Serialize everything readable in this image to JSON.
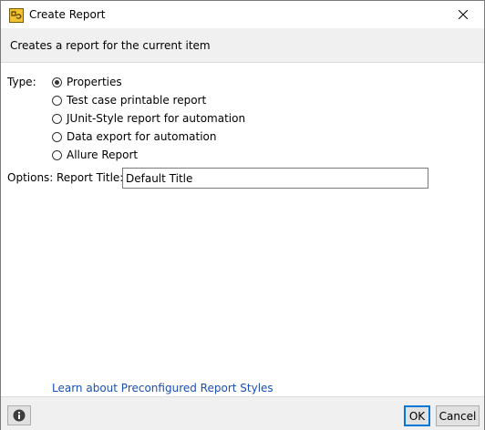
{
  "window": {
    "title": "Create Report",
    "app_icon": "report-app-icon",
    "close_icon": "close-icon"
  },
  "banner": {
    "text": "Creates a report for the current item"
  },
  "form": {
    "type_label": "Type:",
    "report_types": [
      {
        "label": "Properties",
        "selected": true
      },
      {
        "label": "Test case printable report",
        "selected": false
      },
      {
        "label": "JUnit-Style report for automation",
        "selected": false
      },
      {
        "label": "Data export for automation",
        "selected": false
      },
      {
        "label": "Allure Report",
        "selected": false
      }
    ],
    "options_label": "Options:",
    "report_title_label": "Report Title:",
    "report_title_value": "Default Title"
  },
  "link": {
    "text": "Learn about Preconfigured Report Styles"
  },
  "footer": {
    "info_icon": "info-icon",
    "ok_label": "OK",
    "cancel_label": "Cancel"
  },
  "colors": {
    "link": "#1a4fb4",
    "default_button_border": "#0078d7",
    "banner_bg": "#f0f0f0"
  }
}
